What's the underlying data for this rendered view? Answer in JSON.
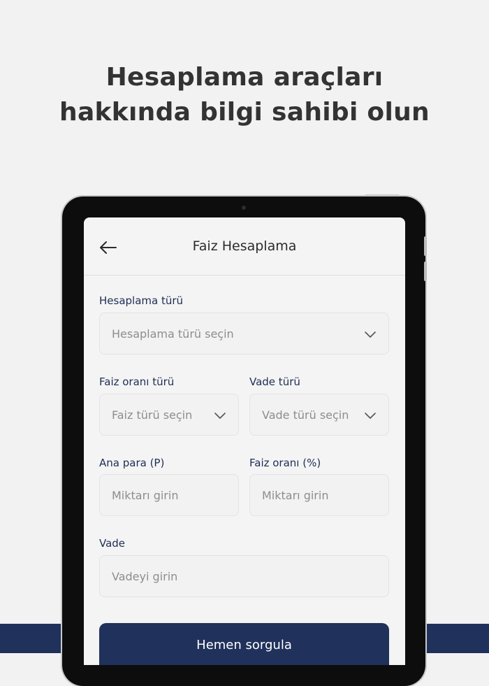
{
  "headline": {
    "line1": "Hesaplama araçları",
    "line2": "hakkında bilgi sahibi olun"
  },
  "app": {
    "title": "Faiz Hesaplama",
    "back_icon": "arrow-left-icon"
  },
  "form": {
    "calculation_type": {
      "label": "Hesaplama türü",
      "placeholder": "Hesaplama türü seçin"
    },
    "interest_rate_type": {
      "label": "Faiz oranı türü",
      "placeholder": "Faiz türü seçin"
    },
    "term_type": {
      "label": "Vade türü",
      "placeholder": "Vade türü seçin"
    },
    "principal": {
      "label": "Ana para (P)",
      "placeholder": "Miktarı girin"
    },
    "interest_rate": {
      "label": "Faiz oranı (%)",
      "placeholder": "Miktarı girin"
    },
    "term": {
      "label": "Vade",
      "placeholder": "Vadeyi girin"
    },
    "submit_label": "Hemen sorgula"
  },
  "colors": {
    "background": "#f2f2f2",
    "brand_navy": "#20315b",
    "label_text": "#1f2d55",
    "placeholder_text": "#8d8d8d"
  }
}
